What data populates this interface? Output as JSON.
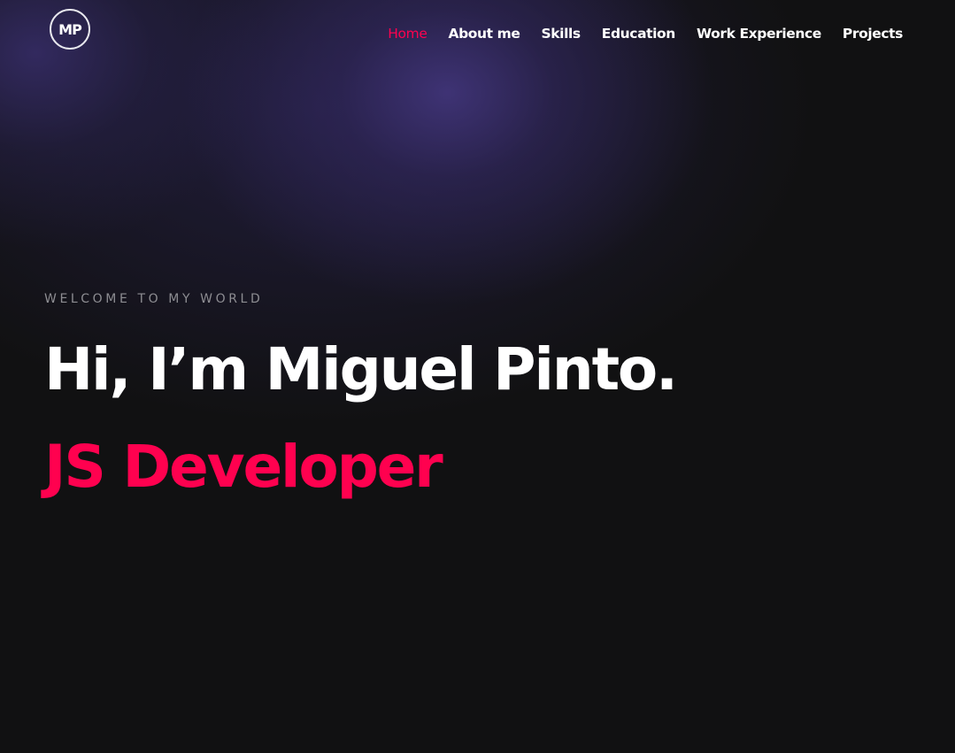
{
  "header": {
    "logo_text": "MP",
    "nav": [
      {
        "label": "Home",
        "active": true
      },
      {
        "label": "About me",
        "active": false
      },
      {
        "label": "Skills",
        "active": false
      },
      {
        "label": "Education",
        "active": false
      },
      {
        "label": "Work Experience",
        "active": false
      },
      {
        "label": "Projects",
        "active": false
      }
    ]
  },
  "hero": {
    "tagline": "WELCOME TO MY WORLD",
    "greeting": "Hi, I’m Miguel Pinto.",
    "role": "JS Developer"
  },
  "colors": {
    "background": "#111112",
    "accent": "#ff014f",
    "text": "#ffffff",
    "muted": "#8d8d92"
  }
}
